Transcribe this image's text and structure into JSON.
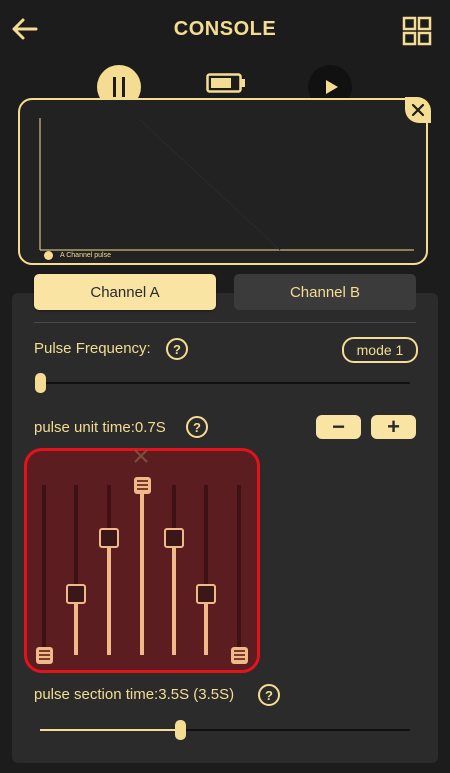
{
  "header": {
    "title": "CONSOLE",
    "back_icon": "back-arrow-icon",
    "menu_icon": "grid-icon"
  },
  "modes": {
    "pause_icon": "pause-icon",
    "battery_icon": "battery-icon",
    "play_icon": "play-icon"
  },
  "preview": {
    "legend": "A Channel pulse",
    "close_icon": "close-icon"
  },
  "tabs": [
    {
      "label": "Channel A",
      "active": true
    },
    {
      "label": "Channel B",
      "active": false
    }
  ],
  "pulse_frequency": {
    "label": "Pulse Frequency:",
    "help": "?",
    "mode_button": "mode 1",
    "slider_value": 0.0
  },
  "pulse_unit": {
    "label": "pulse unit time:0.7S",
    "help": "?",
    "minus": "−",
    "plus": "+"
  },
  "equalizer": {
    "remove_icon": "x-icon",
    "levels": [
      0.0,
      0.35,
      0.67,
      0.97,
      0.67,
      0.35,
      0.0
    ]
  },
  "pulse_section": {
    "label": "pulse section time:3.5S (3.5S)",
    "help": "?",
    "slider_value": 0.51
  },
  "colors": {
    "accent": "#f4dd92",
    "background": "#1c1c1c",
    "panel": "#2b2b2b",
    "highlight_border": "#e5121b",
    "eq_bar": "#f1b98a"
  }
}
